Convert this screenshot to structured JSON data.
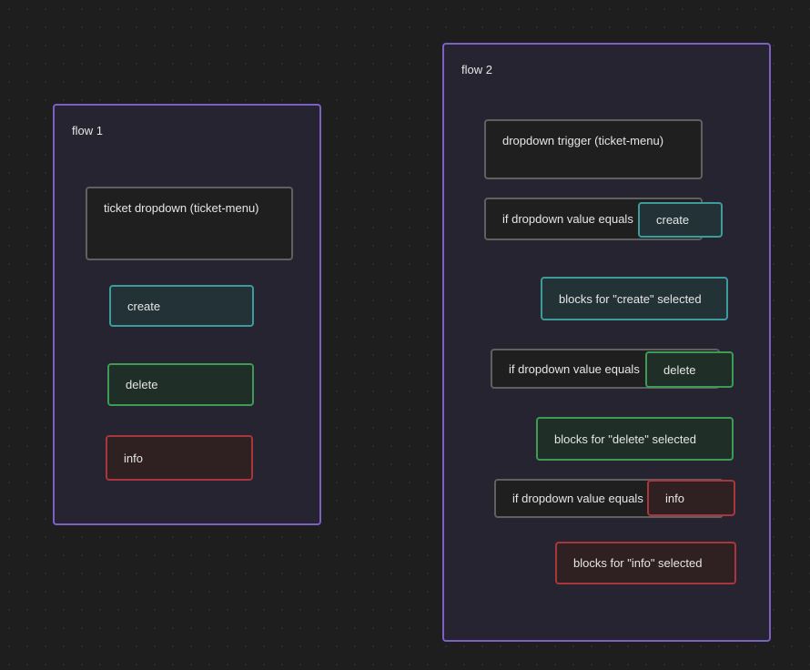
{
  "canvas": {
    "background": "#1e1e1e",
    "dot_color": "#2e2e2e"
  },
  "colors": {
    "group_border": "#7e5fc4",
    "neutral_border": "#606060",
    "create_border": "#3c9b9b",
    "delete_border": "#3c9b55",
    "info_border": "#a8363c"
  },
  "flow1": {
    "label": "flow 1",
    "dropdown_node": "ticket dropdown (ticket-menu)",
    "option_create": "create",
    "option_delete": "delete",
    "option_info": "info"
  },
  "flow2": {
    "label": "flow 2",
    "trigger_node": "dropdown trigger (ticket-menu)",
    "condition_create": {
      "text": "if dropdown value equals",
      "value": "create",
      "blocks": "blocks for \"create\" selected"
    },
    "condition_delete": {
      "text": "if dropdown value equals",
      "value": "delete",
      "blocks": "blocks for \"delete\" selected"
    },
    "condition_info": {
      "text": "if dropdown value equals",
      "value": "info",
      "blocks": "blocks for \"info\" selected"
    }
  }
}
